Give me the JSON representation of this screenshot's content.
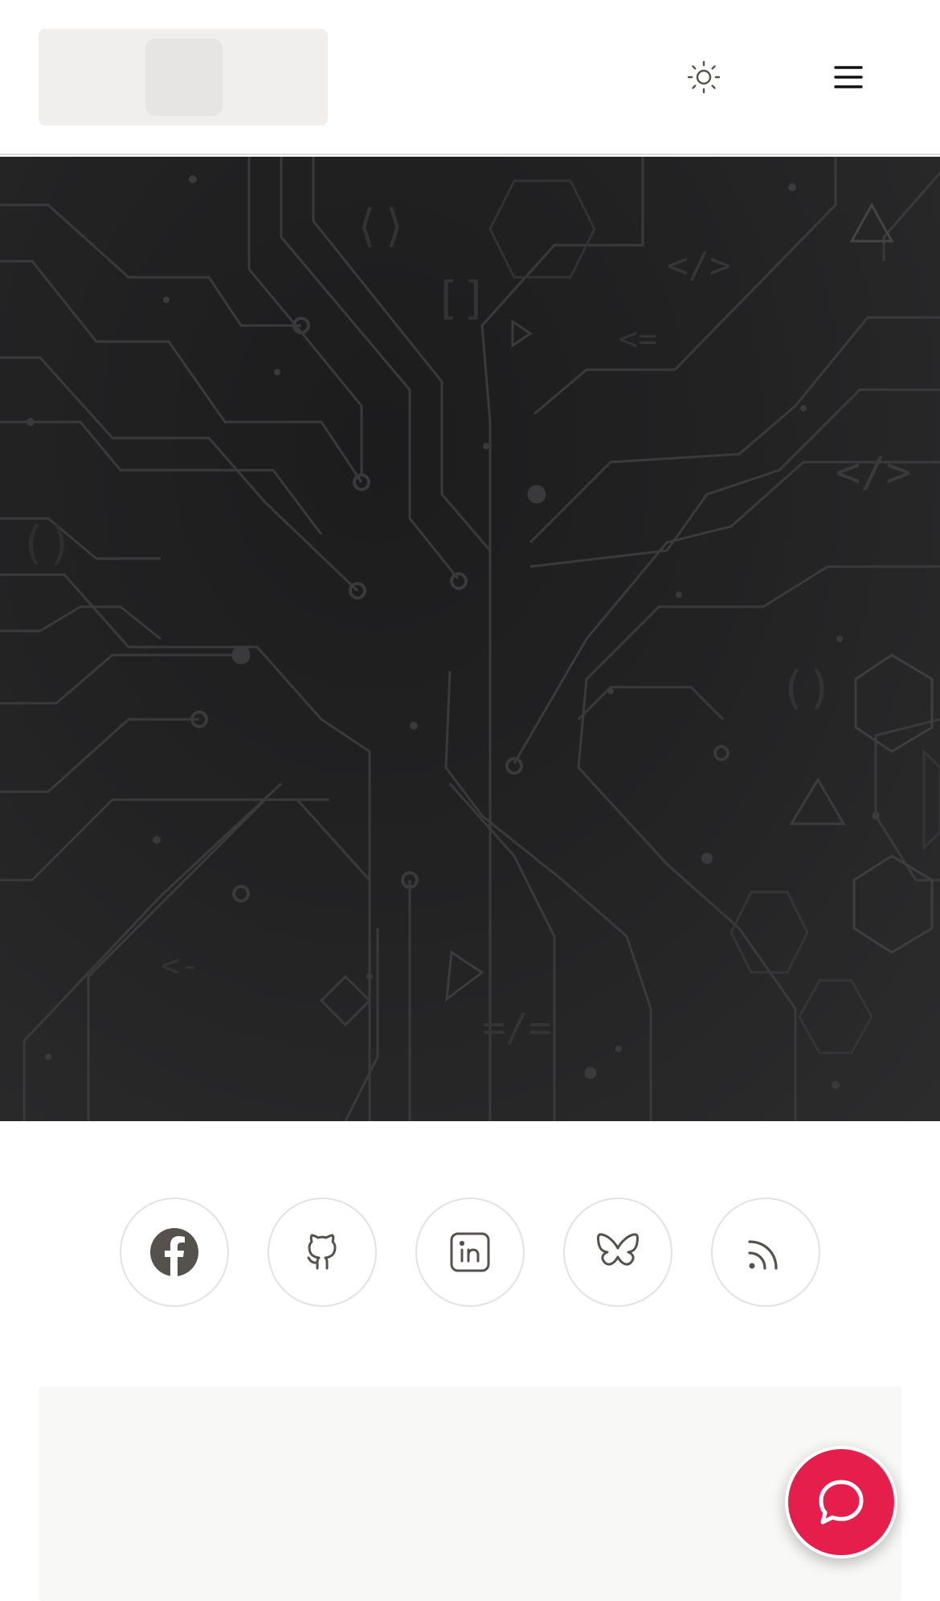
{
  "header": {
    "logo": {
      "icon": "logo-placeholder"
    },
    "theme_toggle": {
      "icon": "sun-icon"
    },
    "menu": {
      "icon": "hamburger-menu-icon"
    }
  },
  "hero": {
    "background": "circuit-board-pattern",
    "colors": {
      "base": "#222223",
      "trace": "#3c3c3e"
    }
  },
  "socials": [
    {
      "name": "facebook",
      "icon": "facebook-icon"
    },
    {
      "name": "github",
      "icon": "github-icon"
    },
    {
      "name": "linkedin",
      "icon": "linkedin-icon"
    },
    {
      "name": "bluesky",
      "icon": "bluesky-icon"
    },
    {
      "name": "rss",
      "icon": "rss-icon"
    }
  ],
  "chat": {
    "icon": "chat-bubble-icon",
    "color": "#e51e4b"
  },
  "colors": {
    "icon_stroke": "#55514d",
    "border": "#e2e2e2"
  }
}
